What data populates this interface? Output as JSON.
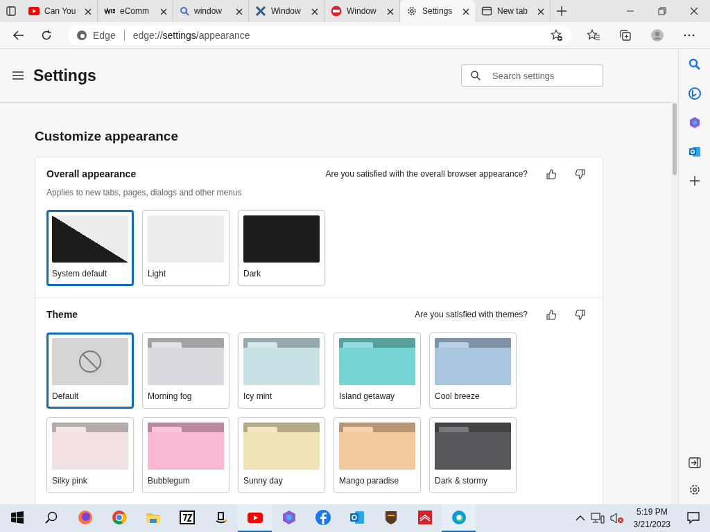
{
  "tabs": [
    {
      "title": "Can You",
      "kind": "youtube",
      "selected": false
    },
    {
      "title": "eComm",
      "kind": "wix",
      "selected": false
    },
    {
      "title": "window",
      "kind": "search",
      "selected": false
    },
    {
      "title": "Window",
      "kind": "cross",
      "selected": false
    },
    {
      "title": "Window",
      "kind": "redcircle",
      "selected": false
    },
    {
      "title": "Settings",
      "kind": "gear",
      "selected": true
    },
    {
      "title": "New tab",
      "kind": "newtab",
      "selected": false
    }
  ],
  "address_bar": {
    "site_label": "Edge",
    "url_scheme": "edge://",
    "url_host": "settings",
    "url_path": "/appearance"
  },
  "settings": {
    "title": "Settings",
    "search": {
      "placeholder": "Search settings"
    },
    "heading": "Customize appearance",
    "sections": [
      {
        "title": "Overall appearance",
        "description": "Applies to new tabs, pages, dialogs and other menus",
        "feedback": "Are you satisfied with the overall browser appearance?",
        "options": [
          {
            "label": "System default",
            "kind": "system",
            "selected": true
          },
          {
            "label": "Light",
            "kind": "light",
            "selected": false
          },
          {
            "label": "Dark",
            "kind": "dark",
            "selected": false
          }
        ]
      },
      {
        "title": "Theme",
        "feedback": "Are you satisfied with themes?",
        "options": [
          {
            "label": "Default",
            "kind": "none",
            "selected": true
          },
          {
            "label": "Morning fog",
            "kind": "theme",
            "color": "#d8d9dc",
            "selected": false
          },
          {
            "label": "Icy mint",
            "kind": "theme",
            "color": "#c8e1e4",
            "selected": false
          },
          {
            "label": "Island getaway",
            "kind": "theme",
            "color": "#76d4d2",
            "selected": false
          },
          {
            "label": "Cool breeze",
            "kind": "theme",
            "color": "#a8c5dd",
            "selected": false
          },
          {
            "label": "Silky pink",
            "kind": "theme",
            "color": "#f1e1e1",
            "selected": false
          },
          {
            "label": "Bubblegum",
            "kind": "theme",
            "color": "#f8b7d2",
            "selected": false
          },
          {
            "label": "Sunny day",
            "kind": "theme",
            "color": "#efe3b5",
            "selected": false
          },
          {
            "label": "Mango paradise",
            "kind": "theme",
            "color": "#f1c99d",
            "selected": false
          },
          {
            "label": "Dark & stormy",
            "kind": "theme",
            "color": "#56585b",
            "selected": false
          }
        ]
      }
    ]
  },
  "taskbar": {
    "apps": [
      {
        "kind": "firefox",
        "running": false
      },
      {
        "kind": "chrome",
        "running": false
      },
      {
        "kind": "folder",
        "running": false
      },
      {
        "kind": "archiver",
        "running": false
      },
      {
        "kind": "amazon",
        "running": false
      },
      {
        "kind": "youtube",
        "running": true
      },
      {
        "kind": "copilot",
        "running": false
      },
      {
        "kind": "facebook",
        "running": false
      },
      {
        "kind": "outlook",
        "running": false
      },
      {
        "kind": "ups",
        "running": false
      },
      {
        "kind": "bank",
        "running": false
      },
      {
        "kind": "edge",
        "running": true
      }
    ],
    "clock": {
      "time": "5:19 PM",
      "date": "3/21/2023"
    }
  }
}
